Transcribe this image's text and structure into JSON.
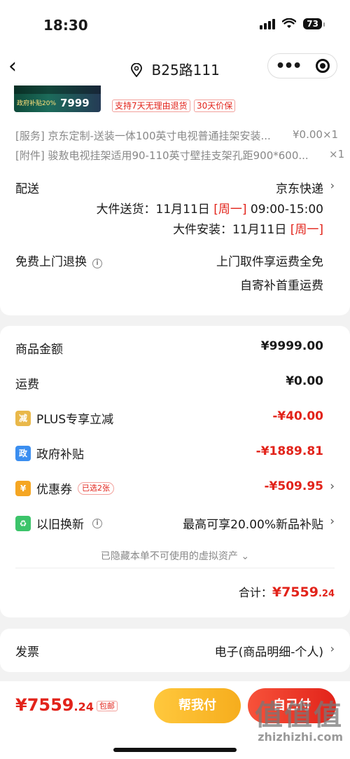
{
  "status_bar": {
    "time": "18:30",
    "battery": "73"
  },
  "nav": {
    "title": "B25路111"
  },
  "product": {
    "thumb_badge": "政府补贴20%",
    "thumb_price": "7999",
    "tags": [
      "支持7天无理由退货",
      "30天价保"
    ]
  },
  "services": [
    {
      "text": "[服务] 京东定制-送装一体100英寸电视普通挂架安装...",
      "value": "¥0.00×1"
    },
    {
      "text": "[附件] 骏敖电视挂架适用90-110英寸壁挂支架孔距900*600...",
      "value": "×1"
    }
  ],
  "delivery": {
    "label": "配送",
    "carrier": "京东快递",
    "send_prefix": "大件送货：11月11日 ",
    "send_day": "[周一]",
    "send_time": " 09:00-15:00",
    "install_prefix": "大件安装：11月11日 ",
    "install_day": "[周一]"
  },
  "return": {
    "label": "免费上门退换",
    "line1": "上门取件享运费全免",
    "line2": "自寄补首重运费"
  },
  "prices": {
    "goods_label": "商品金额",
    "goods_value": "¥9999.00",
    "freight_label": "运费",
    "freight_value": "¥0.00",
    "plus_label": "PLUS专享立减",
    "plus_value": "-¥40.00",
    "gov_label": "政府补贴",
    "gov_value": "-¥1889.81",
    "coupon_label": "优惠券",
    "coupon_pill": "已选2张",
    "coupon_value": "-¥509.95",
    "tradein_label": "以旧换新",
    "tradein_value": "最高可享20.00%新品补贴"
  },
  "hidden_note": "已隐藏本单不可使用的虚拟资产",
  "total": {
    "label": "合计：",
    "amount": "¥7559",
    "decimal": ".24"
  },
  "invoice": {
    "label": "发票",
    "value": "电子(商品明细-个人)"
  },
  "bottom": {
    "price_main": "¥7559",
    "price_decimal": ".24",
    "shipping": "包邮",
    "help_label": "帮我付",
    "pay_label": "自己付"
  },
  "watermark": {
    "logo": "值值值",
    "url": "zhizhizhi.com"
  },
  "colors": {
    "accent": "#e2231a",
    "help_button": "#f6ad1d"
  }
}
